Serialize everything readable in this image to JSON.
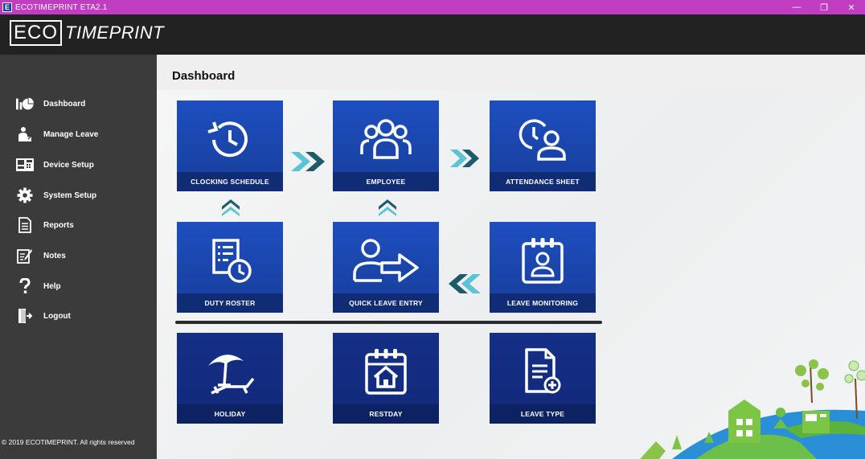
{
  "window": {
    "app_icon_letter": "E",
    "title": "ECOTIMEPRINT ETA2.1",
    "minimize": "—",
    "restore": "❐",
    "close": "✕"
  },
  "header": {
    "logo_eco": "ECO",
    "logo_timeprint": "TIMEPRINT"
  },
  "sidebar": {
    "items": [
      {
        "label": "Dashboard",
        "icon": "dashboard-icon"
      },
      {
        "label": "Manage Leave",
        "icon": "manage-leave-icon"
      },
      {
        "label": "Device Setup",
        "icon": "device-icon"
      },
      {
        "label": "System Setup",
        "icon": "gear-icon"
      },
      {
        "label": "Reports",
        "icon": "reports-icon"
      },
      {
        "label": "Notes",
        "icon": "notes-icon"
      },
      {
        "label": "Help",
        "icon": "help-icon"
      },
      {
        "label": "Logout",
        "icon": "logout-icon"
      }
    ],
    "footer": "© 2019 ECOTIMEPRINT. All rights reserved"
  },
  "main": {
    "title": "Dashboard",
    "tiles": [
      {
        "label": "CLOCKING SCHEDULE",
        "icon": "clock-history-icon"
      },
      {
        "label": "EMPLOYEE",
        "icon": "employee-group-icon"
      },
      {
        "label": "ATTENDANCE SHEET",
        "icon": "attendance-clock-user-icon"
      },
      {
        "label": "DUTY ROSTER",
        "icon": "roster-clock-icon"
      },
      {
        "label": "QUICK LEAVE ENTRY",
        "icon": "user-arrow-right-icon"
      },
      {
        "label": "LEAVE MONITORING",
        "icon": "calendar-user-icon"
      },
      {
        "label": "HOLIDAY",
        "icon": "beach-umbrella-icon"
      },
      {
        "label": "RESTDAY",
        "icon": "calendar-home-icon"
      },
      {
        "label": "LEAVE TYPE",
        "icon": "document-plus-icon"
      }
    ]
  },
  "colors": {
    "titlebar": "#c03cc0",
    "header": "#222222",
    "sidebar": "#3b3b3b",
    "tile": "#1e4fc0",
    "tile_label": "#0f2c74",
    "arrow_dark": "#1f5a6b",
    "arrow_light": "#5cc3d6"
  }
}
